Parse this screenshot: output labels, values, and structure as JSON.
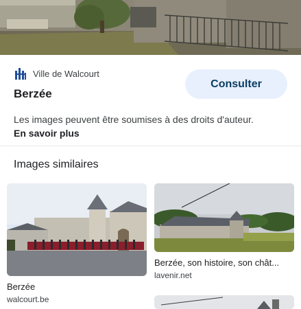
{
  "source": {
    "name": "Ville de Walcourt",
    "logo_icon": "walcourt-logo-icon"
  },
  "title": "Berzée",
  "consult_label": "Consulter",
  "rights": {
    "text": "Les images peuvent être soumises à des droits d'auteur.",
    "link": "En savoir plus"
  },
  "similar": {
    "heading": "Images similaires",
    "items": [
      {
        "caption": "Berzée",
        "source": "walcourt.be"
      },
      {
        "caption": "Berzée, son histoire, son chât...",
        "source": "lavenir.net"
      }
    ]
  },
  "colors": {
    "button_bg": "#e8f0fe",
    "button_text": "#0b3d63",
    "logo_blue": "#1f4e9a"
  }
}
